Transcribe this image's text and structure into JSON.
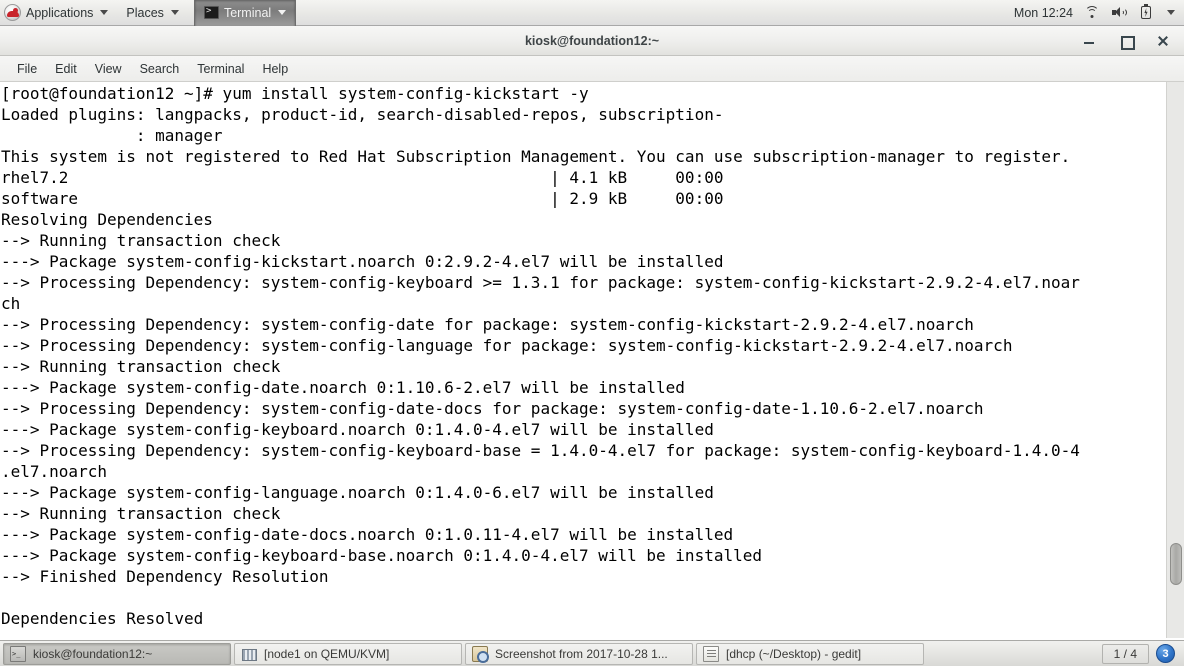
{
  "top_panel": {
    "logo": "redhat-logo",
    "applications_label": "Applications",
    "places_label": "Places",
    "window_label": "Terminal",
    "clock": "Mon 12:24",
    "icons": [
      "wifi-icon",
      "volume-icon",
      "battery-icon",
      "chevron-down-icon"
    ]
  },
  "window": {
    "title": "kiosk@foundation12:~",
    "controls": {
      "minimize": "minimize-button",
      "maximize": "maximize-button",
      "close": "close-button"
    },
    "menu": [
      {
        "label": "File"
      },
      {
        "label": "Edit"
      },
      {
        "label": "View"
      },
      {
        "label": "Search"
      },
      {
        "label": "Terminal"
      },
      {
        "label": "Help"
      }
    ]
  },
  "terminal": {
    "background": "#ffffff",
    "foreground": "#000000",
    "text": "[root@foundation12 ~]# yum install system-config-kickstart -y\nLoaded plugins: langpacks, product-id, search-disabled-repos, subscription-\n              : manager\nThis system is not registered to Red Hat Subscription Management. You can use subscription-manager to register.\nrhel7.2                                                  | 4.1 kB     00:00\nsoftware                                                 | 2.9 kB     00:00\nResolving Dependencies\n--> Running transaction check\n---> Package system-config-kickstart.noarch 0:2.9.2-4.el7 will be installed\n--> Processing Dependency: system-config-keyboard >= 1.3.1 for package: system-config-kickstart-2.9.2-4.el7.noar\nch\n--> Processing Dependency: system-config-date for package: system-config-kickstart-2.9.2-4.el7.noarch\n--> Processing Dependency: system-config-language for package: system-config-kickstart-2.9.2-4.el7.noarch\n--> Running transaction check\n---> Package system-config-date.noarch 0:1.10.6-2.el7 will be installed\n--> Processing Dependency: system-config-date-docs for package: system-config-date-1.10.6-2.el7.noarch\n---> Package system-config-keyboard.noarch 0:1.4.0-4.el7 will be installed\n--> Processing Dependency: system-config-keyboard-base = 1.4.0-4.el7 for package: system-config-keyboard-1.4.0-4\n.el7.noarch\n---> Package system-config-language.noarch 0:1.4.0-6.el7 will be installed\n--> Running transaction check\n---> Package system-config-date-docs.noarch 0:1.0.11-4.el7 will be installed\n---> Package system-config-keyboard-base.noarch 0:1.4.0-4.el7 will be installed\n--> Finished Dependency Resolution\n\nDependencies Resolved"
  },
  "taskbar": {
    "tasks": [
      {
        "label": "kiosk@foundation12:~",
        "icon": "terminal-icon",
        "active": true
      },
      {
        "label": "[node1 on QEMU/KVM]",
        "icon": "virtual-machine-icon",
        "active": false
      },
      {
        "label": "Screenshot from 2017-10-28 1...",
        "icon": "screenshot-icon",
        "active": false
      },
      {
        "label": "[dhcp (~/Desktop) - gedit]",
        "icon": "gedit-icon",
        "active": false
      }
    ],
    "workspace": "1 / 4",
    "notification_count": "3"
  }
}
